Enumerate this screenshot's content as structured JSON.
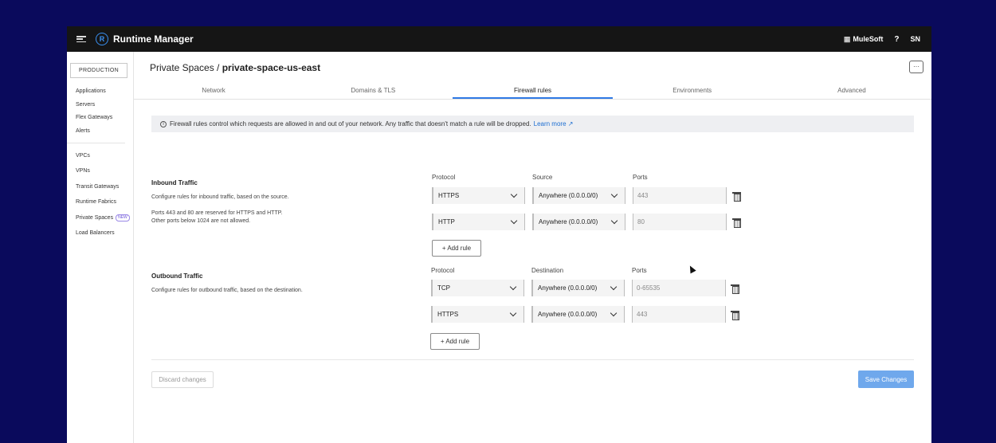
{
  "topbar": {
    "app_title": "Runtime Manager",
    "logo_letter": "R",
    "org_name": "MuleSoft",
    "help": "?",
    "user_initials": "SN"
  },
  "sidebar": {
    "environment": "PRODUCTION",
    "group1": [
      "Applications",
      "Servers",
      "Flex Gateways",
      "Alerts"
    ],
    "group2": [
      "VPCs",
      "VPNs",
      "Transit Gateways",
      "Runtime Fabrics",
      "Private Spaces",
      "Load Balancers"
    ],
    "new_badge": "NEW"
  },
  "header": {
    "breadcrumb_parent": "Private Spaces /",
    "breadcrumb_current": "private-space-us-east",
    "more": "···"
  },
  "tabs": [
    "Network",
    "Domains & TLS",
    "Firewall rules",
    "Environments",
    "Advanced"
  ],
  "banner": {
    "icon": "i",
    "text": "Firewall rules control which requests are allowed in and out of your network. Any traffic that doesn't match a rule will be dropped.",
    "link": "Learn more"
  },
  "inbound": {
    "title": "Inbound Traffic",
    "desc": "Configure rules for inbound traffic, based on the source.",
    "note1": "Ports 443 and 80 are reserved for HTTPS and HTTP.",
    "note2": "Other ports below 1024 are not allowed.",
    "col_protocol": "Protocol",
    "col_source": "Source",
    "col_ports": "Ports",
    "rules": [
      {
        "protocol": "HTTPS",
        "source": "Anywhere (0.0.0.0/0)",
        "ports": "443"
      },
      {
        "protocol": "HTTP",
        "source": "Anywhere (0.0.0.0/0)",
        "ports": "80"
      }
    ],
    "add_rule": "+ Add rule"
  },
  "outbound": {
    "title": "Outbound Traffic",
    "desc": "Configure rules for outbound traffic, based on the destination.",
    "col_protocol": "Protocol",
    "col_destination": "Destination",
    "col_ports": "Ports",
    "rules": [
      {
        "protocol": "TCP",
        "destination": "Anywhere (0.0.0.0/0)",
        "ports": "0-65535"
      },
      {
        "protocol": "HTTPS",
        "destination": "Anywhere (0.0.0.0/0)",
        "ports": "443"
      }
    ],
    "add_rule": "+ Add rule"
  },
  "footer": {
    "discard": "Discard changes",
    "save": "Save Changes"
  },
  "colors": {
    "background": "#0a0a5c",
    "topbar": "#151515",
    "accent": "#2f7ae5",
    "save_button": "#6fa8ec"
  }
}
